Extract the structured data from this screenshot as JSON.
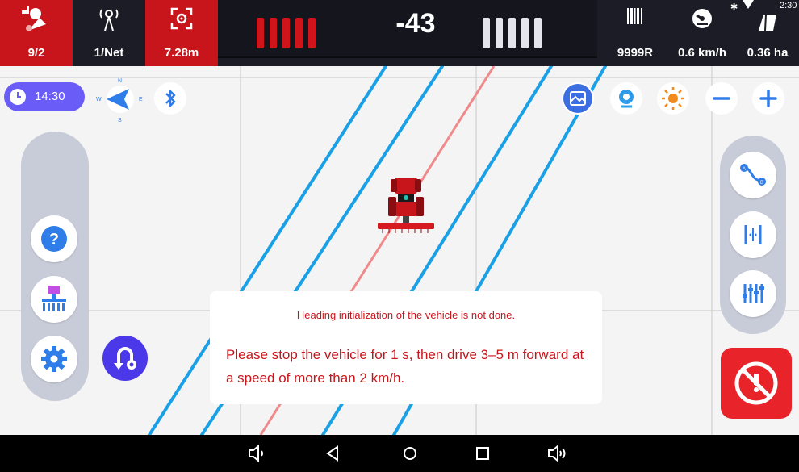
{
  "status_bar": {
    "satellites": "9/2",
    "network": "1/Net",
    "accuracy": "7.28m",
    "deviation": "-43",
    "rows": "9999R",
    "speed": "0.6 km/h",
    "area": "0.36 ha",
    "clock": "2:30"
  },
  "map": {
    "time": "14:30",
    "compass": {
      "n": "N",
      "s": "S",
      "w": "W",
      "e": "E"
    }
  },
  "dialog": {
    "title": "Heading initialization of the vehicle is not done.",
    "message": "Please stop the vehicle for 1 s, then drive 3–5 m forward at a speed of more than 2 km/h."
  },
  "colors": {
    "accent_red": "#c8151c",
    "guide_line": "#1aa0e6",
    "active_line": "#f08a8a",
    "button_purple": "#4b38e8"
  },
  "icons": {
    "satellite": "satellite-icon",
    "antenna": "antenna-icon",
    "accuracy": "target-icon",
    "rows": "barcode-icon",
    "speed": "speedometer-icon",
    "area": "field-icon",
    "bluetooth": "bluetooth-icon",
    "help": "help-icon",
    "implement": "implement-icon",
    "settings": "gear-icon",
    "uturn": "uturn-icon",
    "ab_line": "ab-line-icon",
    "shift": "shift-line-icon",
    "tune": "sliders-icon",
    "stop": "stop-icon"
  }
}
